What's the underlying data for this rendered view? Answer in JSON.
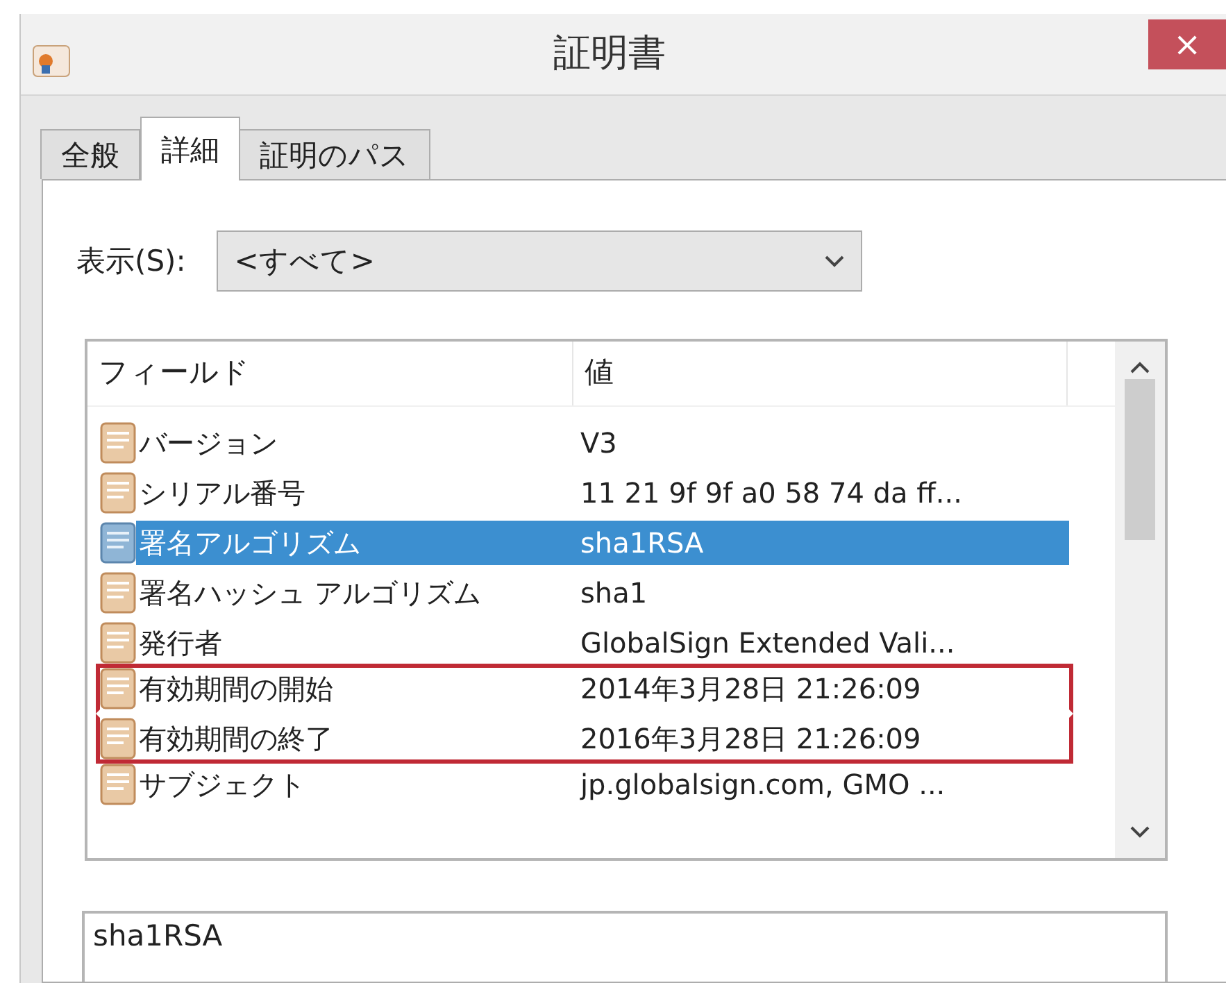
{
  "window": {
    "title": "証明書",
    "close": "×"
  },
  "tabs": [
    {
      "label": "全般",
      "selected": false
    },
    {
      "label": "詳細",
      "selected": true
    },
    {
      "label": "証明のパス",
      "selected": false
    }
  ],
  "show": {
    "label": "表示(S):",
    "value": "<すべて>"
  },
  "table": {
    "columns": [
      "フィールド",
      "値"
    ],
    "rows": [
      {
        "field": "バージョン",
        "value": "V3",
        "selected": false,
        "highlighted": false
      },
      {
        "field": "シリアル番号",
        "value": "11 21 9f 9f a0 58 74 da ff...",
        "selected": false,
        "highlighted": false
      },
      {
        "field": "署名アルゴリズム",
        "value": "sha1RSA",
        "selected": true,
        "highlighted": false
      },
      {
        "field": "署名ハッシュ アルゴリズム",
        "value": "sha1",
        "selected": false,
        "highlighted": false
      },
      {
        "field": "発行者",
        "value": "GlobalSign Extended Vali...",
        "selected": false,
        "highlighted": false
      },
      {
        "field": "有効期間の開始",
        "value": "2014年3月28日 21:26:09",
        "selected": false,
        "highlighted": true
      },
      {
        "field": "有効期間の終了",
        "value": "2016年3月28日 21:26:09",
        "selected": false,
        "highlighted": true
      },
      {
        "field": "サブジェクト",
        "value": "jp.globalsign.com, GMO ...",
        "selected": false,
        "highlighted": false
      }
    ]
  },
  "detail": {
    "value": "sha1RSA"
  }
}
